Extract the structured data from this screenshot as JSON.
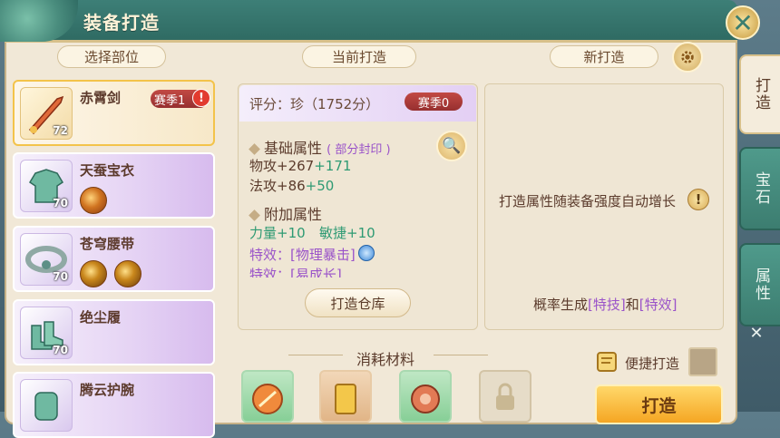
{
  "window": {
    "title": "装备打造",
    "close_symbol": "✕"
  },
  "sections": {
    "parts": "选择部位",
    "current": "当前打造",
    "new": "新打造"
  },
  "items": [
    {
      "name": "赤霄剑",
      "level": "72",
      "season": "赛季1",
      "warn": "!"
    },
    {
      "name": "天蚕宝衣",
      "level": "70"
    },
    {
      "name": "苍穹腰带",
      "level": "70"
    },
    {
      "name": "绝尘履",
      "level": "70"
    },
    {
      "name": "腾云护腕",
      "level": ""
    }
  ],
  "current": {
    "score": "评分：珍（1752分）",
    "season": "赛季0",
    "base_title": "基础属性",
    "base_note": "( 部分封印 )",
    "phys_atk": "物攻+267",
    "phys_atk_bonus": "+171",
    "mag_atk": "法攻+86",
    "mag_atk_bonus": "+50",
    "extra_title": "附加属性",
    "str": "力量+10",
    "agi": "敏捷+10",
    "effect1_label": "特效：",
    "effect1_value": "[物理暴击]",
    "effect2_label": "特效：",
    "effect2_value": "[易成长]",
    "warehouse_button": "打造仓库"
  },
  "new_forge": {
    "hint": "打造属性随装备强度自动增长",
    "hint_icon": "!",
    "rate_prefix": "概率生成",
    "rate_skill": "[特技]",
    "rate_and": "和",
    "rate_effect": "[特效]"
  },
  "tabs": [
    "打造",
    "宝石",
    "属性"
  ],
  "materials_label": "消耗材料",
  "quick_forge": "便捷打造",
  "forge_button": "打造",
  "colors": {
    "accent_green": "#2e9a73",
    "accent_purple": "#9a53c9",
    "gold": "#f5a623"
  }
}
